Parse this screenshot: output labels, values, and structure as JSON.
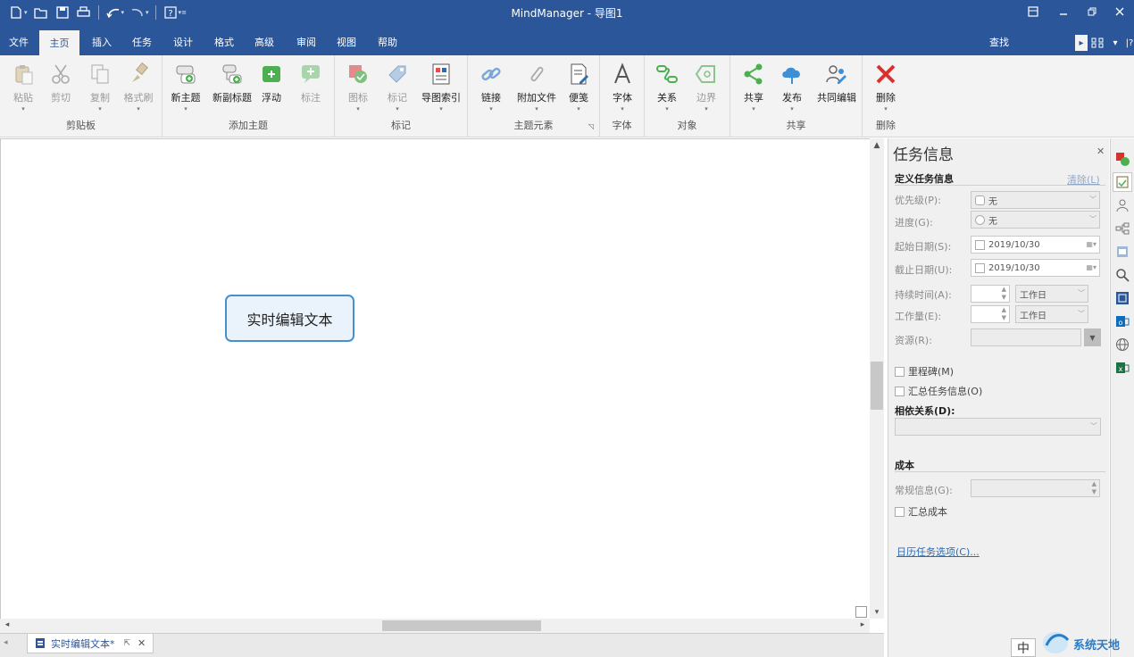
{
  "app_title": "MindManager - 导图1",
  "tabs": [
    "文件",
    "主页",
    "插入",
    "任务",
    "设计",
    "格式",
    "高级",
    "审阅",
    "视图",
    "帮助"
  ],
  "active_tab": "主页",
  "find_label": "查找",
  "ribbon": {
    "clipboard": {
      "label": "剪贴板",
      "paste": "粘贴",
      "cut": "剪切",
      "copy": "复制",
      "format_painter": "格式刷"
    },
    "add_topic": {
      "label": "添加主题",
      "new_topic": "新主题",
      "new_subtopic": "新副标题",
      "floating": "浮动",
      "callout": "标注"
    },
    "markers": {
      "label": "标记",
      "icon": "图标",
      "tag": "标记",
      "map_index": "导图索引"
    },
    "topic_elements": {
      "label": "主题元素",
      "link": "链接",
      "attachment": "附加文件",
      "note": "便笺"
    },
    "font": {
      "label": "字体",
      "font": "字体"
    },
    "objects": {
      "label": "对象",
      "relationship": "关系",
      "boundary": "边界"
    },
    "share": {
      "label": "共享",
      "share": "共享",
      "publish": "发布",
      "co_edit": "共同编辑"
    },
    "delete": {
      "label": "删除",
      "delete": "删除"
    }
  },
  "canvas": {
    "central_topic": "实时编辑文本"
  },
  "doc_tab": {
    "label": "实时编辑文本*"
  },
  "task_pane": {
    "title": "任务信息",
    "define_section": "定义任务信息",
    "clear_link": "清除(L)",
    "priority": {
      "label": "优先级(P):",
      "value": "无"
    },
    "progress": {
      "label": "进度(G):",
      "value": "无"
    },
    "start_date": {
      "label": "起始日期(S):",
      "value": "2019/10/30"
    },
    "due_date": {
      "label": "截止日期(U):",
      "value": "2019/10/30"
    },
    "duration": {
      "label": "持续时间(A):",
      "unit": "工作日"
    },
    "effort": {
      "label": "工作量(E):",
      "unit": "工作日"
    },
    "resources": {
      "label": "资源(R):"
    },
    "milestone": "里程碑(M)",
    "rollup_task": "汇总任务信息(O)",
    "dependencies": "相依关系(D):",
    "cost_section": "成本",
    "general_info": {
      "label": "常规信息(G):"
    },
    "rollup_cost": "汇总成本",
    "calendar_link": "日历任务选项(C)..."
  },
  "watermark": {
    "text": "系统天地",
    "ime": "中"
  },
  "colors": {
    "accent": "#2b579a",
    "ribbon_bg": "#f3f3f3",
    "topic_border": "#4a90c8",
    "topic_fill": "#eaf3fb"
  }
}
